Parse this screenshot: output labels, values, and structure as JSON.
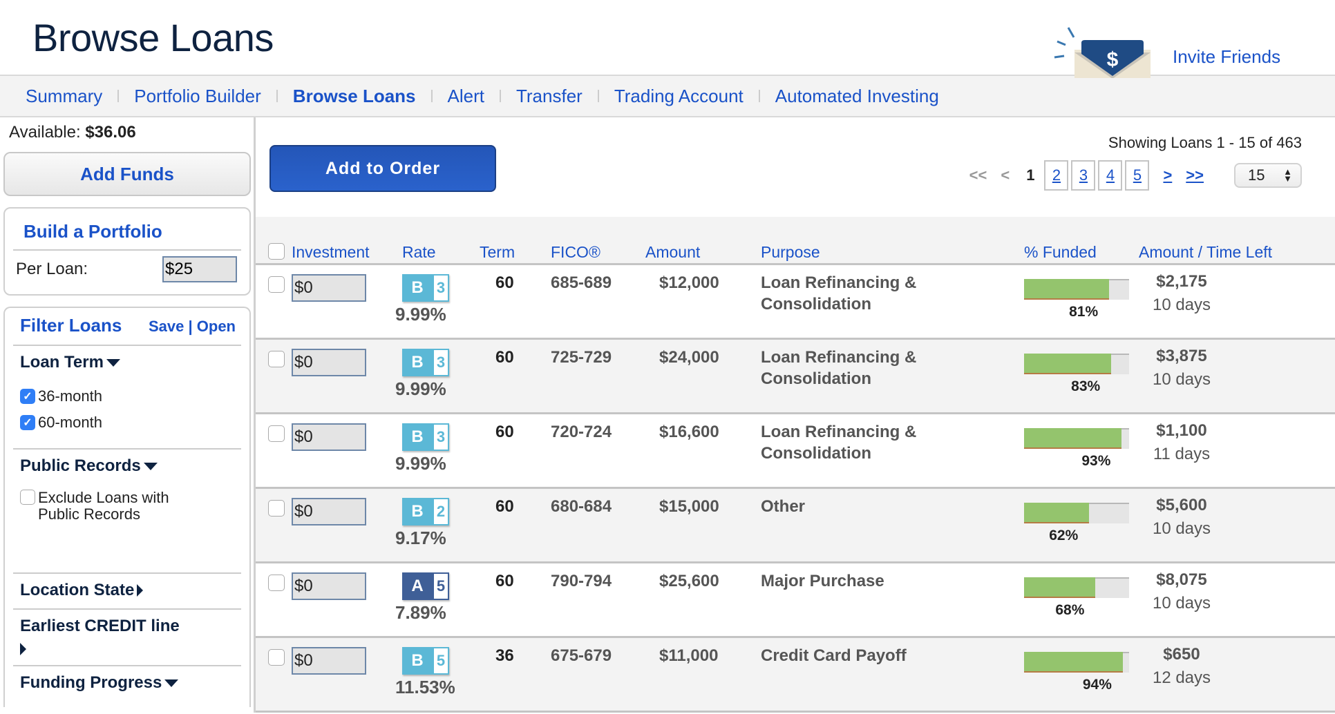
{
  "header": {
    "title": "Browse Loans",
    "invite_label": "Invite Friends",
    "invite_icon": "money-envelope-icon"
  },
  "nav": {
    "items": [
      {
        "label": "Summary",
        "active": false
      },
      {
        "label": "Portfolio Builder",
        "active": false
      },
      {
        "label": "Browse Loans",
        "active": true
      },
      {
        "label": "Alert",
        "active": false
      },
      {
        "label": "Transfer",
        "active": false
      },
      {
        "label": "Trading Account",
        "active": false
      },
      {
        "label": "Automated Investing",
        "active": false
      }
    ]
  },
  "sidebar": {
    "available_label": "Available:",
    "available_value": "$36.06",
    "add_funds_label": "Add Funds",
    "build_portfolio": {
      "title": "Build a Portfolio",
      "per_loan_label": "Per Loan:",
      "per_loan_value": "$25"
    },
    "filter": {
      "title": "Filter Loans",
      "save_label": "Save",
      "separator": "|",
      "open_label": "Open",
      "sections": [
        {
          "title": "Loan Term",
          "expanded": true,
          "options": [
            {
              "label": "36-month",
              "checked": true
            },
            {
              "label": "60-month",
              "checked": true
            }
          ]
        },
        {
          "title": "Public Records",
          "expanded": true,
          "options": [
            {
              "label": "Exclude Loans with Public Records",
              "checked": false
            }
          ]
        },
        {
          "title": "Location State",
          "expanded": false
        },
        {
          "title": "Earliest CREDIT line",
          "expanded": false
        },
        {
          "title": "Funding Progress",
          "expanded": true
        }
      ]
    }
  },
  "main": {
    "add_to_order_label": "Add to Order",
    "showing_text": "Showing Loans 1 - 15 of 463",
    "pager": {
      "first": "<<",
      "prev": "<",
      "current": "1",
      "pages": [
        "2",
        "3",
        "4",
        "5"
      ],
      "next": ">",
      "last": ">>",
      "per_page": "15"
    },
    "columns": [
      "Investment",
      "Rate",
      "Term",
      "FICO®",
      "Amount",
      "Purpose",
      "% Funded",
      "Amount / Time Left"
    ],
    "grade_colors": {
      "A": "#3f5f97",
      "B": "#5bb8d6"
    },
    "loans": [
      {
        "investment": "$0",
        "grade": "B",
        "subgrade": "3",
        "rate": "9.99%",
        "term": "60",
        "fico": "685-689",
        "amount": "$12,000",
        "purpose": "Loan Refinancing & Consolidation",
        "funded_pct": 81,
        "funded_label": "81%",
        "amount_left": "$2,175",
        "time_left": "10 days"
      },
      {
        "investment": "$0",
        "grade": "B",
        "subgrade": "3",
        "rate": "9.99%",
        "term": "60",
        "fico": "725-729",
        "amount": "$24,000",
        "purpose": "Loan Refinancing & Consolidation",
        "funded_pct": 83,
        "funded_label": "83%",
        "amount_left": "$3,875",
        "time_left": "10 days"
      },
      {
        "investment": "$0",
        "grade": "B",
        "subgrade": "3",
        "rate": "9.99%",
        "term": "60",
        "fico": "720-724",
        "amount": "$16,600",
        "purpose": "Loan Refinancing & Consolidation",
        "funded_pct": 93,
        "funded_label": "93%",
        "amount_left": "$1,100",
        "time_left": "11 days"
      },
      {
        "investment": "$0",
        "grade": "B",
        "subgrade": "2",
        "rate": "9.17%",
        "term": "60",
        "fico": "680-684",
        "amount": "$15,000",
        "purpose": "Other",
        "funded_pct": 62,
        "funded_label": "62%",
        "amount_left": "$5,600",
        "time_left": "10 days"
      },
      {
        "investment": "$0",
        "grade": "A",
        "subgrade": "5",
        "rate": "7.89%",
        "term": "60",
        "fico": "790-794",
        "amount": "$25,600",
        "purpose": "Major Purchase",
        "funded_pct": 68,
        "funded_label": "68%",
        "amount_left": "$8,075",
        "time_left": "10 days"
      },
      {
        "investment": "$0",
        "grade": "B",
        "subgrade": "5",
        "rate": "11.53%",
        "term": "36",
        "fico": "675-679",
        "amount": "$11,000",
        "purpose": "Credit Card Payoff",
        "funded_pct": 94,
        "funded_label": "94%",
        "amount_left": "$650",
        "time_left": "12 days"
      }
    ]
  }
}
